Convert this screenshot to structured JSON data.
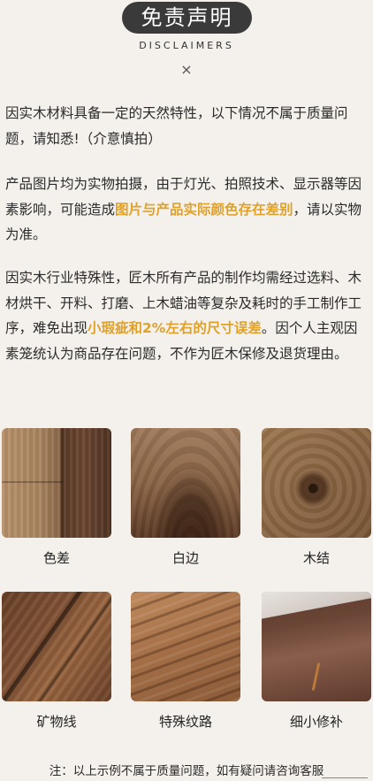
{
  "header": {
    "title": "免责声明",
    "subtitle": "DISCLAIMERS",
    "close_symbol": "×"
  },
  "paragraphs": {
    "p1": "因实木材料具备一定的天然特性，以下情况不属于质量问题，请知悉!（介意慎拍）",
    "p2_pre": "产品图片均为实物拍摄，由于灯光、拍照技术、显示器等因素影响，可能造成",
    "p2_highlight": "图片与产品实际颜色存在差别",
    "p2_post": "，请以实物为准。",
    "p3_pre": "因实木行业特殊性，匠木所有产品的制作均需经过选料、木材烘干、开料、打磨、上木蜡油等复杂及耗时的手工制作工序，难免出现",
    "p3_highlight": "小瑕疵和2%左右的尺寸误差",
    "p3_post": "。因个人主观因素笼统认为商品存在问题，不作为匠木保修及退货理由。"
  },
  "highlight_color": "#e0a12a",
  "samples": [
    {
      "label": "色差"
    },
    {
      "label": "白边"
    },
    {
      "label": "木结"
    },
    {
      "label": "矿物线"
    },
    {
      "label": "特殊纹路"
    },
    {
      "label": "细小修补"
    }
  ],
  "footer": {
    "note": "注：以上示例不属于质量问题，如有疑问请咨询客服"
  }
}
